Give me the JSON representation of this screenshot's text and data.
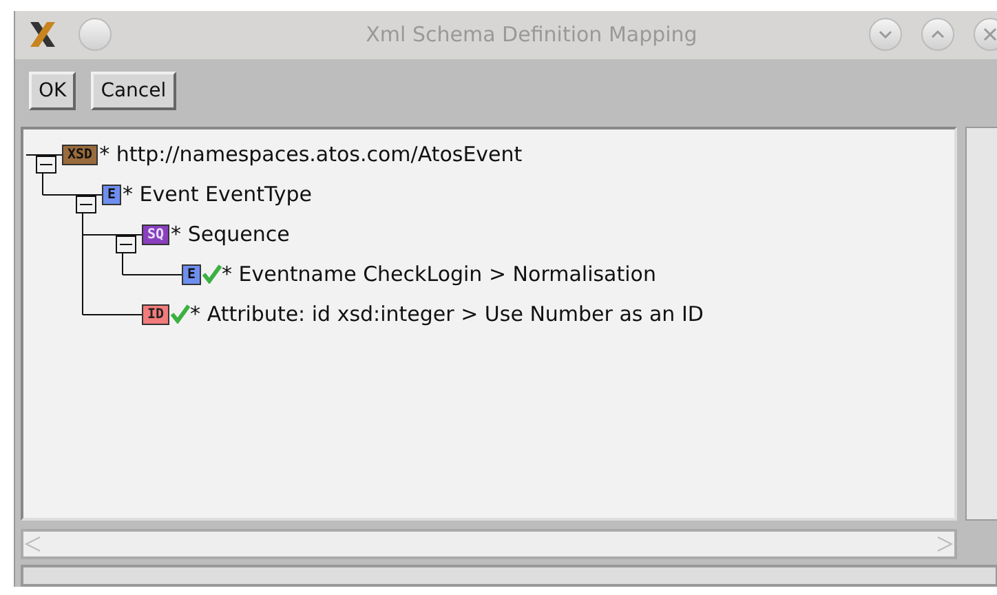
{
  "window": {
    "title": "Xml Schema Definition Mapping"
  },
  "buttons": [
    "OK",
    "Cancel"
  ],
  "tree": [
    {
      "kind": "xsd",
      "icon_label": "XSD",
      "label": "* http://namespaces.atos.com/AtosEvent",
      "checked": false,
      "expanded": true,
      "children": [
        {
          "kind": "element",
          "icon_label": "E",
          "label": "* Event EventType",
          "checked": false,
          "expanded": true,
          "children": [
            {
              "kind": "sequence",
              "icon_label": "SQ",
              "label": "* Sequence",
              "checked": false,
              "expanded": true,
              "children": [
                {
                  "kind": "element",
                  "icon_label": "E",
                  "label": "* Eventname CheckLogin > Normalisation",
                  "checked": true
                }
              ]
            },
            {
              "kind": "attribute",
              "icon_label": "ID",
              "label": "* Attribute: id xsd:integer > Use Number as an ID",
              "checked": true
            }
          ]
        }
      ]
    }
  ]
}
